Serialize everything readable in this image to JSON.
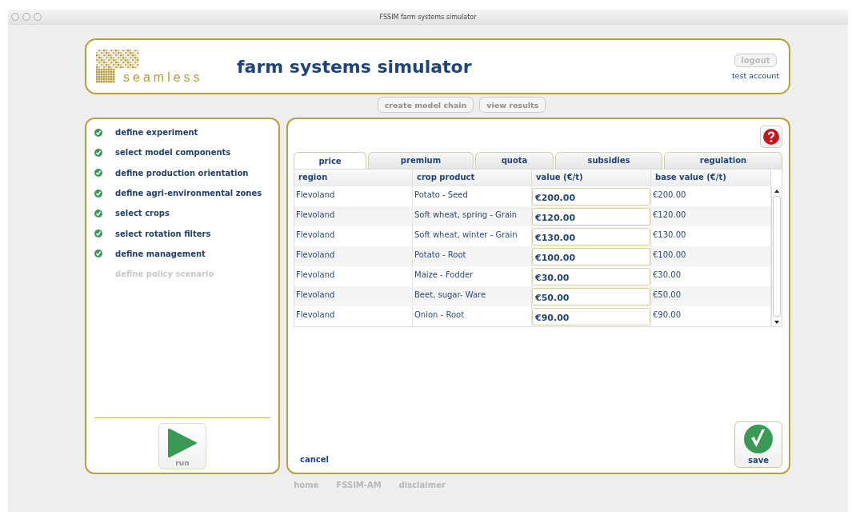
{
  "window": {
    "title": "FSSIM farm systems simulator"
  },
  "header": {
    "logo_text": "seamless",
    "title": "farm systems simulator",
    "logout": "logout",
    "account": "test account"
  },
  "nav_buttons": [
    {
      "label": "create model chain",
      "disabled": true
    },
    {
      "label": "view results",
      "disabled": true
    }
  ],
  "steps": [
    {
      "label": "define experiment",
      "done": true,
      "disabled": false
    },
    {
      "label": "select model components",
      "done": true,
      "disabled": false
    },
    {
      "label": "define production orientation",
      "done": true,
      "disabled": false
    },
    {
      "label": "define agri-environmental zones",
      "done": true,
      "disabled": false
    },
    {
      "label": "select crops",
      "done": true,
      "disabled": false
    },
    {
      "label": "select rotation filters",
      "done": true,
      "disabled": false
    },
    {
      "label": "define management",
      "done": true,
      "disabled": false
    },
    {
      "label": "define policy scenario",
      "done": false,
      "disabled": true
    }
  ],
  "run_button": {
    "label": "run",
    "disabled": true
  },
  "tabs": [
    {
      "label": "price",
      "selected": true
    },
    {
      "label": "premium",
      "selected": false
    },
    {
      "label": "quota",
      "selected": false
    },
    {
      "label": "subsidies",
      "selected": false
    },
    {
      "label": "regulation",
      "selected": false
    }
  ],
  "table": {
    "columns": [
      "region",
      "crop product",
      "value (€/t)",
      "base value (€/t)"
    ],
    "rows": [
      {
        "region": "Flevoland",
        "product": "Potato - Seed",
        "value": "€200.00",
        "base": "€200.00"
      },
      {
        "region": "Flevoland",
        "product": "Soft wheat, spring - Grain",
        "value": "€120.00",
        "base": "€120.00"
      },
      {
        "region": "Flevoland",
        "product": "Soft wheat, winter - Grain",
        "value": "€130.00",
        "base": "€130.00"
      },
      {
        "region": "Flevoland",
        "product": "Potato - Root",
        "value": "€100.00",
        "base": "€100.00"
      },
      {
        "region": "Flevoland",
        "product": "Maize - Fodder",
        "value": "€30.00",
        "base": "€30.00"
      },
      {
        "region": "Flevoland",
        "product": "Beet, sugar- Ware",
        "value": "€50.00",
        "base": "€50.00"
      },
      {
        "region": "Flevoland",
        "product": "Onion - Root",
        "value": "€90.00",
        "base": "€90.00"
      }
    ]
  },
  "cancel": "cancel",
  "save": "save",
  "footer_links": [
    "home",
    "FSSIM-AM",
    "disclaimer"
  ]
}
